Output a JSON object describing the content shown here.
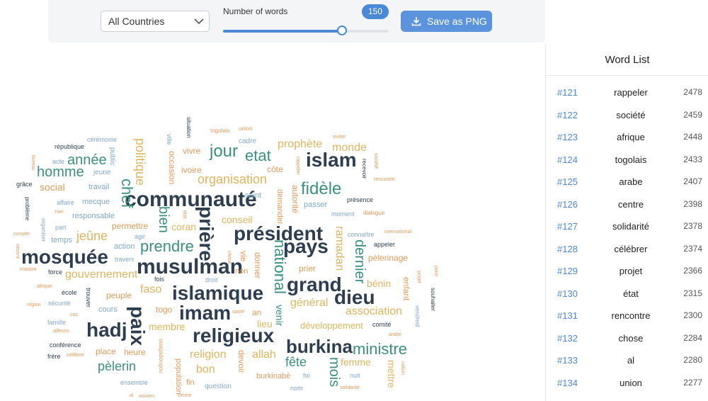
{
  "toolbar": {
    "country_select": "All Countries",
    "slider_label": "Number of words",
    "slider_value": "150",
    "slider_fraction": 0.72,
    "save_label": "Save as PNG"
  },
  "word_list": {
    "title": "Word List",
    "rows": [
      {
        "rank": "#121",
        "word": "rappeler",
        "count": "2478"
      },
      {
        "rank": "#122",
        "word": "société",
        "count": "2459"
      },
      {
        "rank": "#123",
        "word": "afrique",
        "count": "2448"
      },
      {
        "rank": "#124",
        "word": "togolais",
        "count": "2433"
      },
      {
        "rank": "#125",
        "word": "arabe",
        "count": "2407"
      },
      {
        "rank": "#126",
        "word": "centre",
        "count": "2398"
      },
      {
        "rank": "#127",
        "word": "solidarité",
        "count": "2378"
      },
      {
        "rank": "#128",
        "word": "célébrer",
        "count": "2374"
      },
      {
        "rank": "#129",
        "word": "projet",
        "count": "2366"
      },
      {
        "rank": "#130",
        "word": "état",
        "count": "2315"
      },
      {
        "rank": "#131",
        "word": "rencontre",
        "count": "2300"
      },
      {
        "rank": "#132",
        "word": "chose",
        "count": "2284"
      },
      {
        "rank": "#133",
        "word": "al",
        "count": "2280"
      },
      {
        "rank": "#134",
        "word": "union",
        "count": "2277"
      }
    ]
  },
  "colors": {
    "dark": "#2d3e50",
    "teal": "#3a8f7e",
    "gold": "#e0b45c",
    "blue": "#7fa8cc",
    "orange": "#e39a5a",
    "accent": "#4a88d8"
  },
  "cloud": [
    {
      "text": "communauté",
      "color": "dark",
      "size": 30,
      "bold": true
    },
    {
      "text": "président",
      "color": "dark",
      "size": 28,
      "bold": true
    },
    {
      "text": "islam",
      "color": "dark",
      "size": 28,
      "bold": true
    },
    {
      "text": "musulman",
      "color": "dark",
      "size": 30,
      "bold": true
    },
    {
      "text": "mosquée",
      "color": "dark",
      "size": 28,
      "bold": true
    },
    {
      "text": "islamique",
      "color": "dark",
      "size": 28,
      "bold": true
    },
    {
      "text": "grand",
      "color": "dark",
      "size": 28,
      "bold": true
    },
    {
      "text": "pays",
      "color": "dark",
      "size": 28,
      "bold": true
    },
    {
      "text": "imam",
      "color": "dark",
      "size": 28,
      "bold": true
    },
    {
      "text": "dieu",
      "color": "dark",
      "size": 28,
      "bold": true
    },
    {
      "text": "religieux",
      "color": "dark",
      "size": 28,
      "bold": true
    },
    {
      "text": "hadj",
      "color": "dark",
      "size": 28,
      "bold": true
    },
    {
      "text": "paix",
      "color": "dark",
      "size": 28,
      "bold": true
    },
    {
      "text": "burkina",
      "color": "dark",
      "size": 26,
      "bold": true
    },
    {
      "text": "prière",
      "color": "dark",
      "size": 28,
      "bold": true
    },
    {
      "text": "jour",
      "color": "teal",
      "size": 24,
      "bold": false
    },
    {
      "text": "etat",
      "color": "teal",
      "size": 22,
      "bold": false
    },
    {
      "text": "fidèle",
      "color": "teal",
      "size": 24,
      "bold": false
    },
    {
      "text": "homme",
      "color": "teal",
      "size": 20,
      "bold": false
    },
    {
      "text": "année",
      "color": "teal",
      "size": 20,
      "bold": false
    },
    {
      "text": "chef",
      "color": "teal",
      "size": 22,
      "bold": false
    },
    {
      "text": "prendre",
      "color": "teal",
      "size": 22,
      "bold": false
    },
    {
      "text": "national",
      "color": "teal",
      "size": 22,
      "bold": false
    },
    {
      "text": "dernier",
      "color": "teal",
      "size": 20,
      "bold": false
    },
    {
      "text": "ministre",
      "color": "teal",
      "size": 22,
      "bold": false
    },
    {
      "text": "fête",
      "color": "teal",
      "size": 18,
      "bold": false
    },
    {
      "text": "mois",
      "color": "teal",
      "size": 20,
      "bold": false
    },
    {
      "text": "pèlerin",
      "color": "teal",
      "size": 18,
      "bold": false
    },
    {
      "text": "bien",
      "color": "teal",
      "size": 20,
      "bold": false
    },
    {
      "text": "politique",
      "color": "gold",
      "size": 18,
      "bold": false
    },
    {
      "text": "organisation",
      "color": "gold",
      "size": 18,
      "bold": false
    },
    {
      "text": "prophète",
      "color": "gold",
      "size": 16,
      "bold": false
    },
    {
      "text": "monde",
      "color": "gold",
      "size": 16,
      "bold": false
    },
    {
      "text": "jeûne",
      "color": "gold",
      "size": 18,
      "bold": false
    },
    {
      "text": "coran",
      "color": "gold",
      "size": 14,
      "bold": false
    },
    {
      "text": "conseil",
      "color": "gold",
      "size": 14,
      "bold": false
    },
    {
      "text": "ramadan",
      "color": "gold",
      "size": 16,
      "bold": false
    },
    {
      "text": "gouvernement",
      "color": "gold",
      "size": 16,
      "bold": false
    },
    {
      "text": "faso",
      "color": "gold",
      "size": 16,
      "bold": false
    },
    {
      "text": "général",
      "color": "gold",
      "size": 16,
      "bold": false
    },
    {
      "text": "association",
      "color": "gold",
      "size": 16,
      "bold": false
    },
    {
      "text": "bénin",
      "color": "gold",
      "size": 14,
      "bold": false
    },
    {
      "text": "membre",
      "color": "gold",
      "size": 14,
      "bold": false
    },
    {
      "text": "développement",
      "color": "gold",
      "size": 13,
      "bold": false
    },
    {
      "text": "religion",
      "color": "gold",
      "size": 16,
      "bold": false
    },
    {
      "text": "allah",
      "color": "gold",
      "size": 16,
      "bold": false
    },
    {
      "text": "bon",
      "color": "gold",
      "size": 16,
      "bold": false
    },
    {
      "text": "femme",
      "color": "gold",
      "size": 14,
      "bold": false
    },
    {
      "text": "mettre",
      "color": "gold",
      "size": 14,
      "bold": false
    },
    {
      "text": "lieu",
      "color": "gold",
      "size": 14,
      "bold": false
    },
    {
      "text": "social",
      "color": "orange",
      "size": 14,
      "bold": false
    },
    {
      "text": "vivre",
      "color": "orange",
      "size": 12,
      "bold": false
    },
    {
      "text": "occasion",
      "color": "orange",
      "size": 12,
      "bold": false
    },
    {
      "text": "côte",
      "color": "orange",
      "size": 12,
      "bold": false
    },
    {
      "text": "autorité",
      "color": "orange",
      "size": 12,
      "bold": false
    },
    {
      "text": "permettre",
      "color": "orange",
      "size": 12,
      "bold": false
    },
    {
      "text": "pèlerinage",
      "color": "orange",
      "size": 12,
      "bold": false
    },
    {
      "text": "peuple",
      "color": "orange",
      "size": 12,
      "bold": false
    },
    {
      "text": "togo",
      "color": "orange",
      "size": 12,
      "bold": false
    },
    {
      "text": "prier",
      "color": "orange",
      "size": 12,
      "bold": false
    },
    {
      "text": "donner",
      "color": "orange",
      "size": 12,
      "bold": false
    },
    {
      "text": "vie",
      "color": "orange",
      "size": 12,
      "bold": false
    },
    {
      "text": "heure",
      "color": "orange",
      "size": 12,
      "bold": false
    },
    {
      "text": "place",
      "color": "orange",
      "size": 12,
      "bold": false
    },
    {
      "text": "devoir",
      "color": "orange",
      "size": 12,
      "bold": false
    },
    {
      "text": "burkinabè",
      "color": "orange",
      "size": 11,
      "bold": false
    },
    {
      "text": "enfant",
      "color": "orange",
      "size": 12,
      "bold": false
    },
    {
      "text": "population",
      "color": "orange",
      "size": 11,
      "bold": false
    },
    {
      "text": "non",
      "color": "orange",
      "size": 11,
      "bold": false
    },
    {
      "text": "an",
      "color": "orange",
      "size": 12,
      "bold": false
    },
    {
      "text": "fin",
      "color": "orange",
      "size": 11,
      "bold": false
    },
    {
      "text": "ivoire",
      "color": "orange",
      "size": 12,
      "bold": false
    },
    {
      "text": "demander",
      "color": "orange",
      "size": 11,
      "bold": false
    },
    {
      "text": "venir",
      "color": "teal",
      "size": 14,
      "bold": false
    },
    {
      "text": "temps",
      "color": "blue",
      "size": 11,
      "bold": false
    },
    {
      "text": "travail",
      "color": "blue",
      "size": 11,
      "bold": false
    },
    {
      "text": "mecque",
      "color": "blue",
      "size": 11,
      "bold": false
    },
    {
      "text": "responsable",
      "color": "blue",
      "size": 11,
      "bold": false
    },
    {
      "text": "action",
      "color": "blue",
      "size": 11,
      "bold": false
    },
    {
      "text": "cours",
      "color": "blue",
      "size": 11,
      "bold": false
    },
    {
      "text": "passer",
      "color": "blue",
      "size": 11,
      "bold": false
    },
    {
      "text": "saint",
      "color": "blue",
      "size": 11,
      "bold": false
    },
    {
      "text": "cadre",
      "color": "blue",
      "size": 10,
      "bold": false
    },
    {
      "text": "jeune",
      "color": "blue",
      "size": 10,
      "bold": false
    },
    {
      "text": "public",
      "color": "blue",
      "size": 10,
      "bold": false
    },
    {
      "text": "ville",
      "color": "blue",
      "size": 9,
      "bold": false
    },
    {
      "text": "question",
      "color": "blue",
      "size": 10,
      "bold": false
    },
    {
      "text": "ensemble",
      "color": "blue",
      "size": 9,
      "bold": false
    },
    {
      "text": "acte",
      "color": "blue",
      "size": 9,
      "bold": false
    },
    {
      "text": "part",
      "color": "blue",
      "size": 9,
      "bold": false
    },
    {
      "text": "affaire",
      "color": "blue",
      "size": 9,
      "bold": false
    },
    {
      "text": "cérémonie",
      "color": "blue",
      "size": 9,
      "bold": false
    },
    {
      "text": "droit",
      "color": "blue",
      "size": 9,
      "bold": false
    },
    {
      "text": "moment",
      "color": "blue",
      "size": 9,
      "bold": false
    },
    {
      "text": "connaître",
      "color": "blue",
      "size": 9,
      "bold": false
    },
    {
      "text": "agir",
      "color": "blue",
      "size": 9,
      "bold": false
    },
    {
      "text": "famille",
      "color": "blue",
      "size": 9,
      "bold": false
    },
    {
      "text": "nuit",
      "color": "blue",
      "size": 9,
      "bold": false
    },
    {
      "text": "nom",
      "color": "blue",
      "size": 9,
      "bold": false
    },
    {
      "text": "foi",
      "color": "blue",
      "size": 9,
      "bold": false
    },
    {
      "text": "vendredi",
      "color": "blue",
      "size": 8,
      "bold": false
    },
    {
      "text": "organiser",
      "color": "blue",
      "size": 8,
      "bold": false
    },
    {
      "text": "sécurité",
      "color": "blue",
      "size": 9,
      "bold": false
    },
    {
      "text": "république",
      "color": "dark",
      "size": 9,
      "bold": false
    },
    {
      "text": "grâce",
      "color": "dark",
      "size": 9,
      "bold": false
    },
    {
      "text": "problème",
      "color": "dark",
      "size": 8,
      "bold": false
    },
    {
      "text": "situation",
      "color": "dark",
      "size": 8,
      "bold": false
    },
    {
      "text": "recevoir",
      "color": "dark",
      "size": 8,
      "bold": false
    },
    {
      "text": "présence",
      "color": "dark",
      "size": 9,
      "bold": false
    },
    {
      "text": "appeler",
      "color": "dark",
      "size": 9,
      "bold": false
    },
    {
      "text": "comité",
      "color": "dark",
      "size": 9,
      "bold": false
    },
    {
      "text": "force",
      "color": "dark",
      "size": 9,
      "bold": false
    },
    {
      "text": "école",
      "color": "dark",
      "size": 9,
      "bold": false
    },
    {
      "text": "fois",
      "color": "dark",
      "size": 9,
      "bold": false
    },
    {
      "text": "trouver",
      "color": "dark",
      "size": 9,
      "bold": false
    },
    {
      "text": "conférence",
      "color": "dark",
      "size": 9,
      "bold": false
    },
    {
      "text": "frère",
      "color": "dark",
      "size": 9,
      "bold": false
    },
    {
      "text": "souhaiter",
      "color": "dark",
      "size": 8,
      "bold": false
    },
    {
      "text": "togolais",
      "color": "orange",
      "size": 8,
      "bold": false
    },
    {
      "text": "union",
      "color": "orange",
      "size": 8,
      "bold": false
    },
    {
      "text": "inviter",
      "color": "orange",
      "size": 7,
      "bold": false
    },
    {
      "text": "rappeler",
      "color": "orange",
      "size": 7,
      "bold": false
    },
    {
      "text": "société",
      "color": "orange",
      "size": 7,
      "bold": false
    },
    {
      "text": "rencontre",
      "color": "orange",
      "size": 7,
      "bold": false
    },
    {
      "text": "dialogue",
      "color": "orange",
      "size": 8,
      "bold": false
    },
    {
      "text": "international",
      "color": "orange",
      "size": 7,
      "bold": false
    },
    {
      "text": "bureau",
      "color": "orange",
      "size": 7,
      "bold": false
    },
    {
      "text": "hier",
      "color": "orange",
      "size": 7,
      "bold": false
    },
    {
      "text": "compte",
      "color": "orange",
      "size": 7,
      "bold": false
    },
    {
      "text": "oeuvre",
      "color": "orange",
      "size": 7,
      "bold": false
    },
    {
      "text": "mouton",
      "color": "orange",
      "size": 7,
      "bold": false
    },
    {
      "text": "afrique",
      "color": "orange",
      "size": 7,
      "bold": false
    },
    {
      "text": "région",
      "color": "orange",
      "size": 7,
      "bold": false
    },
    {
      "text": "cas",
      "color": "orange",
      "size": 7,
      "bold": false
    },
    {
      "text": "ailleurs",
      "color": "orange",
      "size": 7,
      "bold": false
    },
    {
      "text": "célébrer",
      "color": "orange",
      "size": 7,
      "bold": false
    },
    {
      "text": "ouagadougou",
      "color": "orange",
      "size": 8,
      "bold": false
    },
    {
      "text": "ivoirien",
      "color": "orange",
      "size": 7,
      "bold": false
    },
    {
      "text": "centre",
      "color": "orange",
      "size": 7,
      "bold": false
    },
    {
      "text": "solidarité",
      "color": "orange",
      "size": 7,
      "bold": false
    },
    {
      "text": "nation",
      "color": "orange",
      "size": 7,
      "bold": false
    },
    {
      "text": "arabe",
      "color": "orange",
      "size": 7,
      "bold": false
    },
    {
      "text": "projet",
      "color": "orange",
      "size": 7,
      "bold": false
    },
    {
      "text": "point",
      "color": "orange",
      "size": 7,
      "bold": false
    },
    {
      "text": "chose",
      "color": "orange",
      "size": 7,
      "bold": false
    },
    {
      "text": "état",
      "color": "orange",
      "size": 7,
      "bold": false
    },
    {
      "text": "al",
      "color": "orange",
      "size": 7,
      "bold": false
    },
    {
      "text": "santé",
      "color": "orange",
      "size": 7,
      "bold": false
    },
    {
      "text": "travers",
      "color": "blue",
      "size": 9,
      "bold": false
    }
  ]
}
